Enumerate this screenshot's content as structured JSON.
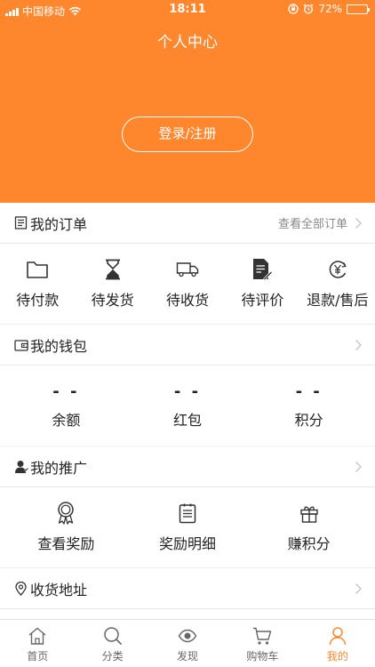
{
  "status_bar": {
    "carrier": "中国移动",
    "time": "18:11",
    "battery": "72%",
    "battery_level": 0.72
  },
  "header": {
    "title": "个人中心",
    "login_label": "登录/注册",
    "bg_color": "#fe872e"
  },
  "orders": {
    "title": "我的订单",
    "view_all": "查看全部订单",
    "items": [
      {
        "label": "待付款",
        "icon": "folder-icon"
      },
      {
        "label": "待发货",
        "icon": "hourglass-icon"
      },
      {
        "label": "待收货",
        "icon": "delivery-truck-icon"
      },
      {
        "label": "待评价",
        "icon": "document-pen-icon"
      },
      {
        "label": "退款/售后",
        "icon": "refund-yen-icon"
      }
    ]
  },
  "wallet": {
    "title": "我的钱包",
    "items": [
      {
        "value": "- -",
        "label": "余额"
      },
      {
        "value": "- -",
        "label": "红包"
      },
      {
        "value": "- -",
        "label": "积分"
      }
    ]
  },
  "promotion": {
    "title": "我的推广",
    "items": [
      {
        "label": "查看奖励",
        "icon": "award-ribbon-icon"
      },
      {
        "label": "奖励明细",
        "icon": "clipboard-list-icon"
      },
      {
        "label": "赚积分",
        "icon": "gift-icon"
      }
    ]
  },
  "address": {
    "title": "收货地址"
  },
  "tabbar": {
    "active_color": "#fe872e",
    "items": [
      {
        "label": "首页",
        "icon": "home-icon"
      },
      {
        "label": "分类",
        "icon": "search-icon"
      },
      {
        "label": "发现",
        "icon": "eye-icon"
      },
      {
        "label": "购物车",
        "icon": "cart-icon"
      },
      {
        "label": "我的",
        "icon": "person-icon",
        "active": true
      }
    ]
  }
}
